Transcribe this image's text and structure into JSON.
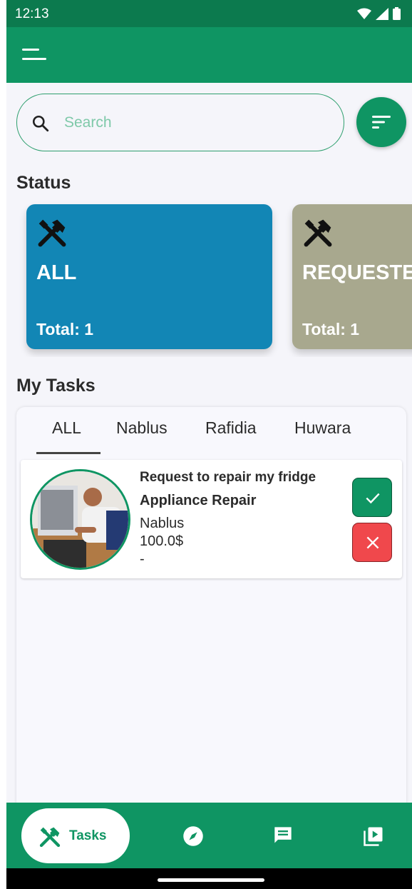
{
  "status_bar": {
    "time": "12:13"
  },
  "search": {
    "placeholder": "Search"
  },
  "sections": {
    "status_title": "Status",
    "tasks_title": "My Tasks"
  },
  "status_cards": [
    {
      "label": "ALL",
      "total": "Total: 1",
      "color": "#1286B5"
    },
    {
      "label": "REQUESTED",
      "total": "Total: 1",
      "color": "#A8A88E"
    }
  ],
  "tabs": [
    {
      "label": "ALL",
      "selected": true
    },
    {
      "label": "Nablus",
      "selected": false
    },
    {
      "label": "Rafidia",
      "selected": false
    },
    {
      "label": "Huwara",
      "selected": false
    }
  ],
  "task": {
    "title": "Request to repair my fridge",
    "category": "Appliance Repair",
    "city": "Nablus",
    "price": "100.0$",
    "note": "-"
  },
  "bottom_nav": {
    "active_label": "Tasks",
    "items": [
      "tools-icon",
      "explore-icon",
      "chat-icon",
      "video-library-icon"
    ]
  },
  "colors": {
    "primary": "#0F9563",
    "primary_dark": "#0C7A4E",
    "reject": "#F0484C",
    "all_card": "#1286B5",
    "requested_card": "#A8A88E"
  }
}
